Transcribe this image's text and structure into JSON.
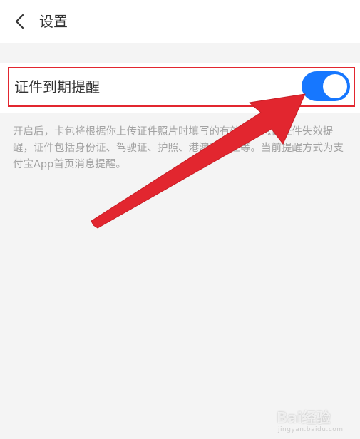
{
  "header": {
    "title": "设置",
    "back_icon": "chevron-left-icon"
  },
  "setting": {
    "label": "证件到期提醒",
    "toggle_state": "on",
    "toggle_color": "#1677ff"
  },
  "description": "开启后，卡包将根据你上传证件照片时填写的有效期信息做证件失效提醒，证件包括身份证、驾驶证、护照、港澳通行证等。当前提醒方式为支付宝App首页消息提醒。",
  "annotation": {
    "highlight_color": "#e2262f",
    "arrow_color": "#e2262f"
  },
  "watermark": {
    "text": "Bai经验",
    "sub": "jingyan.baidu.com"
  }
}
